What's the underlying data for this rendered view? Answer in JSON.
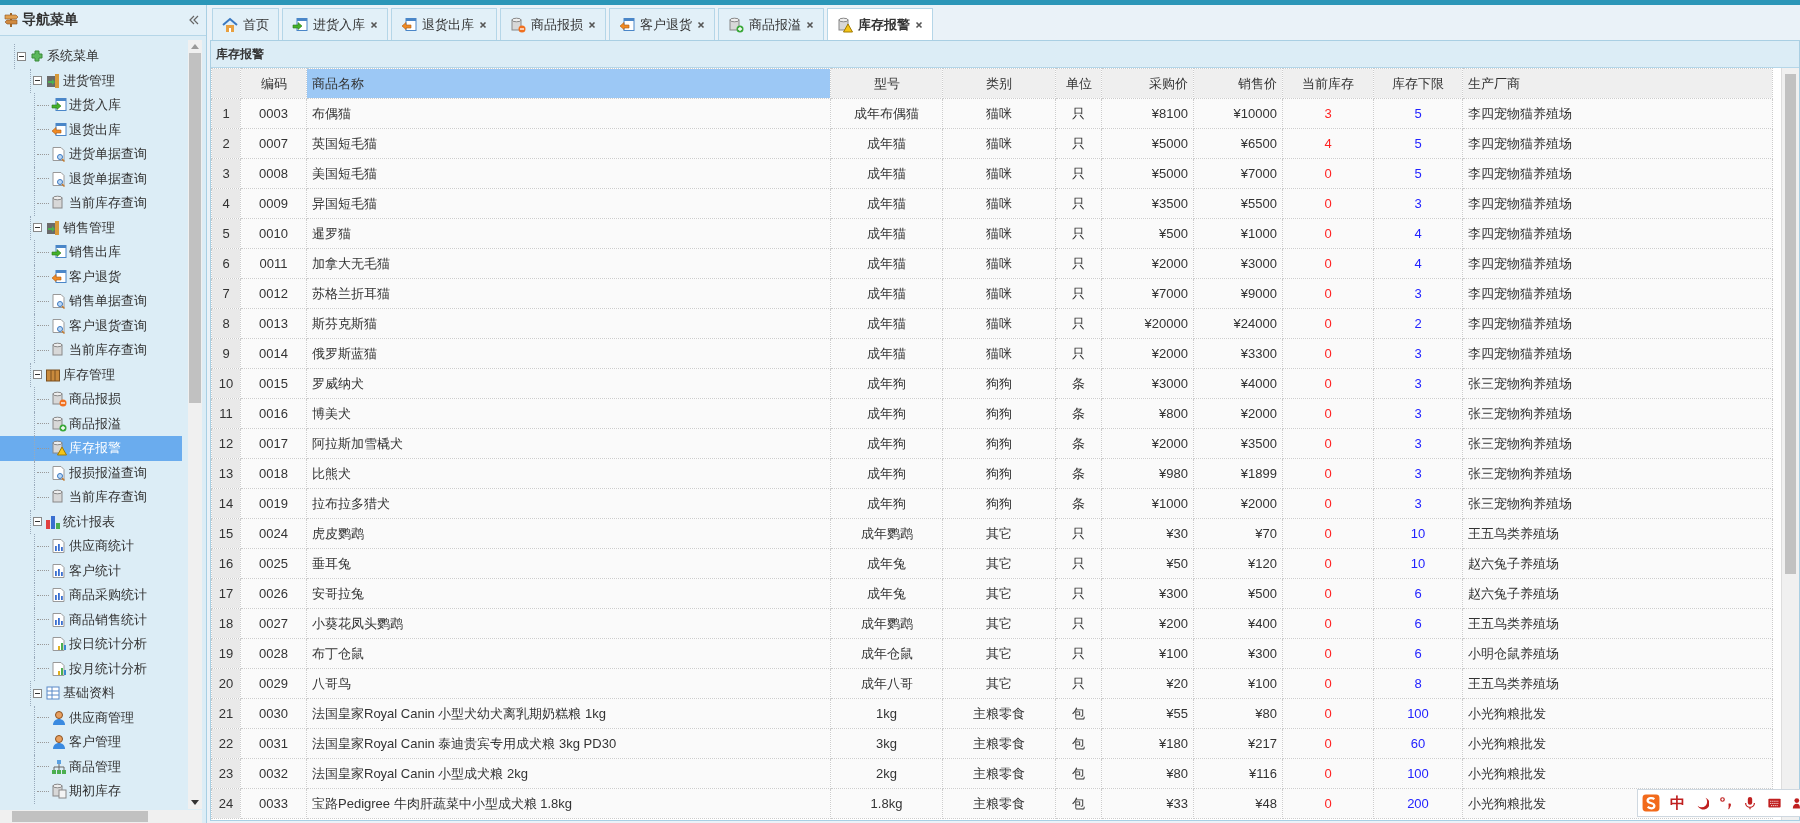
{
  "sidebar": {
    "title": "导航菜单",
    "tree": {
      "label": "系统菜单",
      "kind": "root",
      "expanded": true,
      "selected": false,
      "children": [
        {
          "label": "进货管理",
          "kind": "door",
          "expanded": true,
          "selected": false,
          "children": [
            {
              "label": "进货入库",
              "kind": "in",
              "selected": false
            },
            {
              "label": "退货出库",
              "kind": "out",
              "selected": false
            },
            {
              "label": "进货单据查询",
              "kind": "query",
              "selected": false
            },
            {
              "label": "退货单据查询",
              "kind": "query",
              "selected": false
            },
            {
              "label": "当前库存查询",
              "kind": "stock",
              "selected": false
            }
          ]
        },
        {
          "label": "销售管理",
          "kind": "door",
          "expanded": true,
          "selected": false,
          "children": [
            {
              "label": "销售出库",
              "kind": "in",
              "selected": false
            },
            {
              "label": "客户退货",
              "kind": "out",
              "selected": false
            },
            {
              "label": "销售单据查询",
              "kind": "query",
              "selected": false
            },
            {
              "label": "客户退货查询",
              "kind": "query",
              "selected": false
            },
            {
              "label": "当前库存查询",
              "kind": "stock",
              "selected": false
            }
          ]
        },
        {
          "label": "库存管理",
          "kind": "box",
          "expanded": true,
          "selected": false,
          "children": [
            {
              "label": "商品报损",
              "kind": "loss",
              "selected": false
            },
            {
              "label": "商品报溢",
              "kind": "overflow",
              "selected": false
            },
            {
              "label": "库存报警",
              "kind": "alert",
              "selected": true
            },
            {
              "label": "报损报溢查询",
              "kind": "query",
              "selected": false
            },
            {
              "label": "当前库存查询",
              "kind": "stock",
              "selected": false
            }
          ]
        },
        {
          "label": "统计报表",
          "kind": "bars",
          "expanded": true,
          "selected": false,
          "children": [
            {
              "label": "供应商统计",
              "kind": "chart",
              "selected": false
            },
            {
              "label": "客户统计",
              "kind": "chart",
              "selected": false
            },
            {
              "label": "商品采购统计",
              "kind": "chart",
              "selected": false
            },
            {
              "label": "商品销售统计",
              "kind": "chart",
              "selected": false
            },
            {
              "label": "按日统计分析",
              "kind": "trend",
              "selected": false
            },
            {
              "label": "按月统计分析",
              "kind": "trend",
              "selected": false
            }
          ]
        },
        {
          "label": "基础资料",
          "kind": "form",
          "expanded": true,
          "selected": false,
          "children": [
            {
              "label": "供应商管理",
              "kind": "user",
              "selected": false
            },
            {
              "label": "客户管理",
              "kind": "user",
              "selected": false
            },
            {
              "label": "商品管理",
              "kind": "org",
              "selected": false
            },
            {
              "label": "期初库存",
              "kind": "archive",
              "selected": false
            }
          ]
        }
      ]
    }
  },
  "tabs": [
    {
      "label": "首页",
      "kind": "home",
      "closable": false,
      "selected": false
    },
    {
      "label": "进货入库",
      "kind": "in",
      "closable": true,
      "selected": false
    },
    {
      "label": "退货出库",
      "kind": "out",
      "closable": true,
      "selected": false
    },
    {
      "label": "商品报损",
      "kind": "loss",
      "closable": true,
      "selected": false
    },
    {
      "label": "客户退货",
      "kind": "out",
      "closable": true,
      "selected": false
    },
    {
      "label": "商品报溢",
      "kind": "overflow",
      "closable": true,
      "selected": false
    },
    {
      "label": "库存报警",
      "kind": "alert",
      "closable": true,
      "selected": true
    }
  ],
  "panel": {
    "title": "库存报警"
  },
  "table": {
    "columns": [
      {
        "selected": false
      },
      {
        "label": "编码",
        "selected": false
      },
      {
        "label": "商品名称",
        "selected": true
      },
      {
        "label": "型号",
        "selected": false
      },
      {
        "label": "类别",
        "selected": false
      },
      {
        "label": "单位",
        "selected": false
      },
      {
        "label": "采购价",
        "selected": false
      },
      {
        "label": "销售价",
        "selected": false
      },
      {
        "label": "当前库存",
        "selected": false
      },
      {
        "label": "库存下限",
        "selected": false
      },
      {
        "label": "生产厂商",
        "selected": false
      }
    ],
    "rows": [
      [
        "1",
        "0003",
        "布偶猫",
        "成年布偶猫",
        "猫咪",
        "只",
        "¥8100",
        "¥10000",
        "3",
        "5",
        "李四宠物猫养殖场"
      ],
      [
        "2",
        "0007",
        "英国短毛猫",
        "成年猫",
        "猫咪",
        "只",
        "¥5000",
        "¥6500",
        "4",
        "5",
        "李四宠物猫养殖场"
      ],
      [
        "3",
        "0008",
        "美国短毛猫",
        "成年猫",
        "猫咪",
        "只",
        "¥5000",
        "¥7000",
        "0",
        "5",
        "李四宠物猫养殖场"
      ],
      [
        "4",
        "0009",
        "异国短毛猫",
        "成年猫",
        "猫咪",
        "只",
        "¥3500",
        "¥5500",
        "0",
        "3",
        "李四宠物猫养殖场"
      ],
      [
        "5",
        "0010",
        "暹罗猫",
        "成年猫",
        "猫咪",
        "只",
        "¥500",
        "¥1000",
        "0",
        "4",
        "李四宠物猫养殖场"
      ],
      [
        "6",
        "0011",
        "加拿大无毛猫",
        "成年猫",
        "猫咪",
        "只",
        "¥2000",
        "¥3000",
        "0",
        "4",
        "李四宠物猫养殖场"
      ],
      [
        "7",
        "0012",
        "苏格兰折耳猫",
        "成年猫",
        "猫咪",
        "只",
        "¥7000",
        "¥9000",
        "0",
        "3",
        "李四宠物猫养殖场"
      ],
      [
        "8",
        "0013",
        "斯芬克斯猫",
        "成年猫",
        "猫咪",
        "只",
        "¥20000",
        "¥24000",
        "0",
        "2",
        "李四宠物猫养殖场"
      ],
      [
        "9",
        "0014",
        "俄罗斯蓝猫",
        "成年猫",
        "猫咪",
        "只",
        "¥2000",
        "¥3300",
        "0",
        "3",
        "李四宠物猫养殖场"
      ],
      [
        "10",
        "0015",
        "罗威纳犬",
        "成年狗",
        "狗狗",
        "条",
        "¥3000",
        "¥4000",
        "0",
        "3",
        "张三宠物狗养殖场"
      ],
      [
        "11",
        "0016",
        "博美犬",
        "成年狗",
        "狗狗",
        "条",
        "¥800",
        "¥2000",
        "0",
        "3",
        "张三宠物狗养殖场"
      ],
      [
        "12",
        "0017",
        "阿拉斯加雪橇犬",
        "成年狗",
        "狗狗",
        "条",
        "¥2000",
        "¥3500",
        "0",
        "3",
        "张三宠物狗养殖场"
      ],
      [
        "13",
        "0018",
        "比熊犬",
        "成年狗",
        "狗狗",
        "条",
        "¥980",
        "¥1899",
        "0",
        "3",
        "张三宠物狗养殖场"
      ],
      [
        "14",
        "0019",
        "拉布拉多猎犬",
        "成年狗",
        "狗狗",
        "条",
        "¥1000",
        "¥2000",
        "0",
        "3",
        "张三宠物狗养殖场"
      ],
      [
        "15",
        "0024",
        "虎皮鹦鹉",
        "成年鹦鹉",
        "其它",
        "只",
        "¥30",
        "¥70",
        "0",
        "10",
        "王五鸟类养殖场"
      ],
      [
        "16",
        "0025",
        "垂耳兔",
        "成年兔",
        "其它",
        "只",
        "¥50",
        "¥120",
        "0",
        "10",
        "赵六兔子养殖场"
      ],
      [
        "17",
        "0026",
        "安哥拉兔",
        "成年兔",
        "其它",
        "只",
        "¥300",
        "¥500",
        "0",
        "6",
        "赵六兔子养殖场"
      ],
      [
        "18",
        "0027",
        "小葵花凤头鹦鹉",
        "成年鹦鹉",
        "其它",
        "只",
        "¥200",
        "¥400",
        "0",
        "6",
        "王五鸟类养殖场"
      ],
      [
        "19",
        "0028",
        "布丁仓鼠",
        "成年仓鼠",
        "其它",
        "只",
        "¥100",
        "¥300",
        "0",
        "6",
        "小明仓鼠养殖场"
      ],
      [
        "20",
        "0029",
        "八哥鸟",
        "成年八哥",
        "其它",
        "只",
        "¥20",
        "¥100",
        "0",
        "8",
        "王五鸟类养殖场"
      ],
      [
        "21",
        "0030",
        "法国皇家Royal Canin 小型犬幼犬离乳期奶糕粮 1kg",
        "1kg",
        "主粮零食",
        "包",
        "¥55",
        "¥80",
        "0",
        "100",
        "小光狗粮批发"
      ],
      [
        "22",
        "0031",
        "法国皇家Royal Canin 泰迪贵宾专用成犬粮 3kg PD30",
        "3kg",
        "主粮零食",
        "包",
        "¥180",
        "¥217",
        "0",
        "60",
        "小光狗粮批发"
      ],
      [
        "23",
        "0032",
        "法国皇家Royal Canin 小型成犬粮 2kg",
        "2kg",
        "主粮零食",
        "包",
        "¥80",
        "¥116",
        "0",
        "100",
        "小光狗粮批发"
      ],
      [
        "24",
        "0033",
        "宝路Pedigree 牛肉肝蔬菜中小型成犬粮 1.8kg",
        "1.8kg",
        "主粮零食",
        "包",
        "¥33",
        "¥48",
        "0",
        "200",
        "小光狗粮批发"
      ]
    ]
  },
  "ime_toolbar": {
    "mode": "中"
  }
}
